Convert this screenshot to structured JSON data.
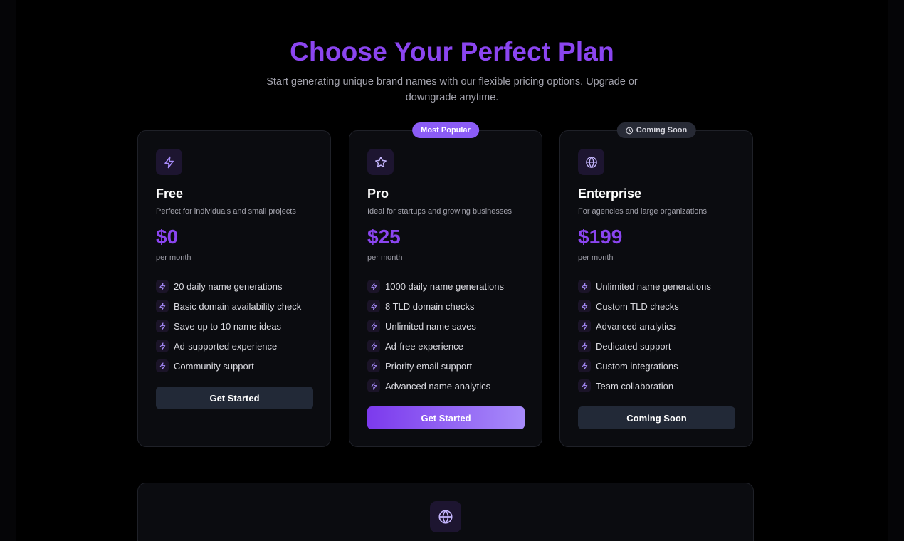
{
  "hero": {
    "title": "Choose Your Perfect Plan",
    "subtitle": "Start generating unique brand names with our flexible pricing options. Upgrade or downgrade anytime."
  },
  "colors": {
    "accent": "#8b45f0",
    "card_bg": "#0b0c10",
    "page_bg": "#000000"
  },
  "plans": [
    {
      "icon": "lightning-icon",
      "name": "Free",
      "description": "Perfect for individuals and small projects",
      "price": "$0",
      "period": "per month",
      "features": [
        "20 daily name generations",
        "Basic domain availability check",
        "Save up to 10 name ideas",
        "Ad-supported experience",
        "Community support"
      ],
      "button_label": "Get Started"
    },
    {
      "badge": "Most Popular",
      "icon": "star-icon",
      "name": "Pro",
      "description": "Ideal for startups and growing businesses",
      "price": "$25",
      "period": "per month",
      "features": [
        "1000 daily name generations",
        "8 TLD domain checks",
        "Unlimited name saves",
        "Ad-free experience",
        "Priority email support",
        "Advanced name analytics"
      ],
      "button_label": "Get Started"
    },
    {
      "badge": "Coming Soon",
      "icon": "globe-icon",
      "name": "Enterprise",
      "description": "For agencies and large organizations",
      "price": "$199",
      "period": "per month",
      "features": [
        "Unlimited name generations",
        "Custom TLD checks",
        "Advanced analytics",
        "Dedicated support",
        "Custom integrations",
        "Team collaboration"
      ],
      "button_label": "Coming Soon"
    }
  ],
  "bottom_section": {
    "icon": "globe-icon"
  }
}
